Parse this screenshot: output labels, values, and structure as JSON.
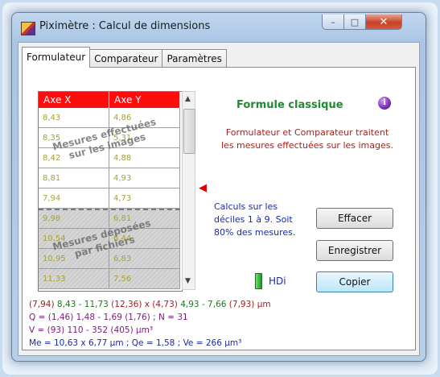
{
  "window": {
    "title": "Piximètre : Calcul de dimensions",
    "caption": {
      "minimize": "–",
      "maximize": "□",
      "close": "✕"
    }
  },
  "tabs": [
    {
      "label": "Formulateur",
      "active": true
    },
    {
      "label": "Comparateur",
      "active": false
    },
    {
      "label": "Paramètres",
      "active": false
    }
  ],
  "table": {
    "headers": [
      "Axe X",
      "Axe Y"
    ],
    "header_color": "#ff0d0d",
    "image_rows": [
      [
        "8,43",
        "4,86"
      ],
      [
        "8,35",
        "5,31"
      ],
      [
        "8,42",
        "4,88"
      ],
      [
        "8,81",
        "4,93"
      ],
      [
        "7,94",
        "4,73"
      ]
    ],
    "file_rows": [
      [
        "9,98",
        "6,81"
      ],
      [
        "10,54",
        "6,44"
      ],
      [
        "10,95",
        "6,83"
      ],
      [
        "11,33",
        "7,56"
      ]
    ],
    "overlay_images": "Mesures effectuées\nsur les images",
    "overlay_files": "Mesures déposées\npar fichiers"
  },
  "panel": {
    "formula_title": "Formule classique",
    "info_icon": "i",
    "description": "Formulateur et Comparateur traitent les mesures effectuées sur les images.",
    "calc_note": "Calculs sur les déciles 1 à 9. Soit 80% des mesures.",
    "hd_label": "HDi",
    "accent_green": "#1f8a2f"
  },
  "buttons": {
    "clear": "Effacer",
    "save": "Enregistrer",
    "copy": "Copier"
  },
  "results": {
    "line1_red_a": "(7,94) ",
    "line1_green_a": "8,43 - 11,73",
    "line1_red_b": " (12,36) x (4,73) ",
    "line1_green_b": "4,93 - 7,66",
    "line1_red_c": " (7,93) µm",
    "line2": "Q = (1,46) 1,48 - 1,69 (1,76) ; N = 31",
    "line3": "V = (93) 110 - 352 (405) µm³",
    "line4": "Me = 10,63 x 6,77 µm ; Qe = 1,58 ; Ve = 266 µm³"
  },
  "scrollbar": {
    "up": "▲",
    "down": "▼"
  },
  "arrow_marker": "◀"
}
